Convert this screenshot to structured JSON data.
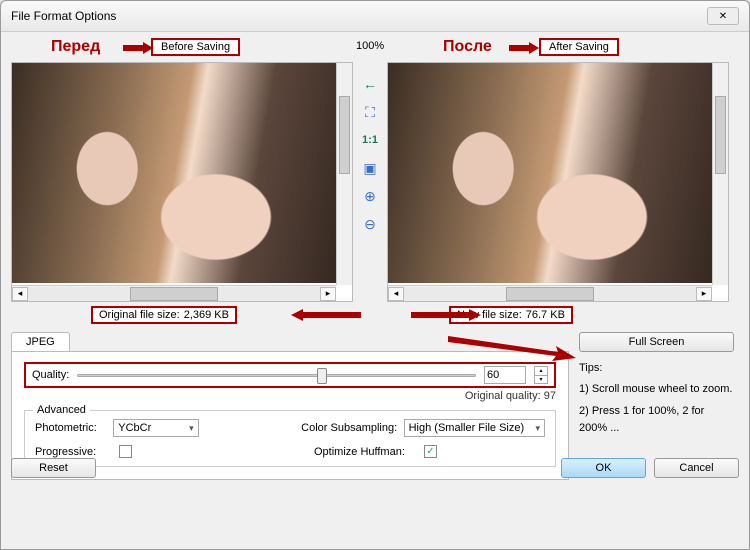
{
  "window": {
    "title": "File Format Options"
  },
  "annotations": {
    "before_ru": "Перед",
    "after_ru": "После",
    "before_label": "Before Saving",
    "after_label": "After Saving"
  },
  "zoom": "100%",
  "toolbar_icons": {
    "prev": "←",
    "fit": "⛶",
    "actual": "1:1",
    "fit_window": "▣",
    "zoom_in": "⊕",
    "zoom_out": "⊖"
  },
  "file_sizes": {
    "original_label": "Original file size:",
    "original_value": "2,369 KB",
    "new_label": "New file size:",
    "new_value": "76.7 KB"
  },
  "tab": {
    "jpeg": "JPEG"
  },
  "quality": {
    "label": "Quality:",
    "value": "60",
    "original_label": "Original quality:",
    "original_value": "97"
  },
  "advanced": {
    "legend": "Advanced",
    "photometric_label": "Photometric:",
    "photometric_value": "YCbCr",
    "subsampling_label": "Color Subsampling:",
    "subsampling_value": "High (Smaller File Size)",
    "progressive_label": "Progressive:",
    "huffman_label": "Optimize Huffman:",
    "huffman_checked": true
  },
  "buttons": {
    "full_screen": "Full Screen",
    "ok": "OK",
    "cancel": "Cancel",
    "reset": "Reset"
  },
  "tips": {
    "title": "Tips:",
    "tip1": "1) Scroll mouse wheel to zoom.",
    "tip2": "2) Press 1 for 100%, 2 for 200% ..."
  }
}
